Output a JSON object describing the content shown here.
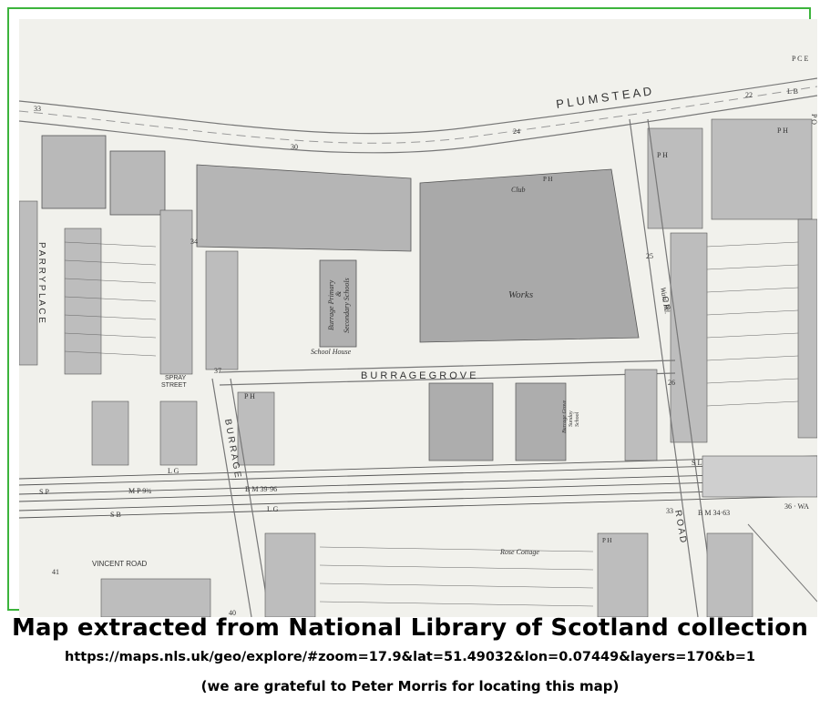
{
  "map": {
    "labels": {
      "plumstead": "P L U M S T E A D",
      "pce": "P C E",
      "lb": "L B",
      "po": "P O",
      "parry_place": "P A R R Y   P L A C E",
      "burrage_grove": "B U R R A G E   G R O V E",
      "burrage": "B U R R A G E",
      "spray_street_1": "SPRAY",
      "spray_street_2": "STREET",
      "vincent_road": "VINCENT ROAD",
      "works": "Works",
      "club": "Club",
      "school_house": "School House",
      "schools_1": "Burrage Primary",
      "schools_2": "&",
      "schools_3": "Secondary Schools",
      "sunday_school_1": "Burrage Grove",
      "sunday_school_2": "Sunday",
      "sunday_school_3": "School",
      "rose_cottage": "Rose Cottage",
      "ward_rd": "Ward Rd.",
      "road_letters": "R O A D",
      "cr": "C R",
      "bm_1": "B M 39·96",
      "bm_2": "B M 34·63",
      "mp": "M P 9¾",
      "sb": "S B",
      "sp": "S P",
      "lg_1": "L G",
      "lg_2": "L G",
      "sl": "S L",
      "wa": "36 · WA",
      "ph_1": "P H",
      "ph_2": "P H",
      "ph_3": "P H",
      "ph_4": "P H",
      "ph_5": "P H",
      "n30": "30",
      "n33a": "33",
      "n22": "22",
      "n24": "24",
      "n34": "34",
      "n37": "37",
      "n33b": "33",
      "n41": "41",
      "n40": "40",
      "n25": "25",
      "n26": "26"
    }
  },
  "caption": {
    "title": "Map extracted from National Library of Scotland collection",
    "url": "https://maps.nls.uk/geo/explore/#zoom=17.9&lat=51.49032&lon=0.07449&layers=170&b=1",
    "credit": "(we are grateful to Peter Morris for locating this map)"
  }
}
